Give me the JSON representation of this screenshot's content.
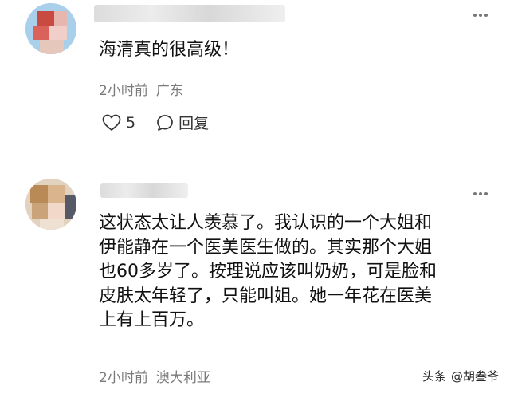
{
  "comments": [
    {
      "user_name": "",
      "text": "海清真的很高级！",
      "time": "2小时前",
      "location": "广东",
      "like_count": "5",
      "reply_label": "回复",
      "icons": {
        "like": "heart-outline-icon",
        "reply": "speech-bubble-icon",
        "more": "more-dots-icon"
      }
    },
    {
      "user_name": "",
      "lines": [
        "这状态太让人羡慕了。我认识的一个大姐和",
        "伊能静在一个医美医生做的。其实那个大姐",
        "也60多岁了。按理说应该叫奶奶，可是脸和",
        "皮肤太年轻了，只能叫姐。她一年花在医美",
        "上有上百万。"
      ],
      "time": "2小时前",
      "location": "澳大利亚",
      "icons": {
        "more": "more-dots-icon"
      }
    }
  ],
  "watermark": {
    "platform": "头条",
    "handle": "@胡叁爷"
  },
  "colors": {
    "text": "#111111",
    "meta": "#7a7a7a",
    "background": "#ffffff"
  }
}
